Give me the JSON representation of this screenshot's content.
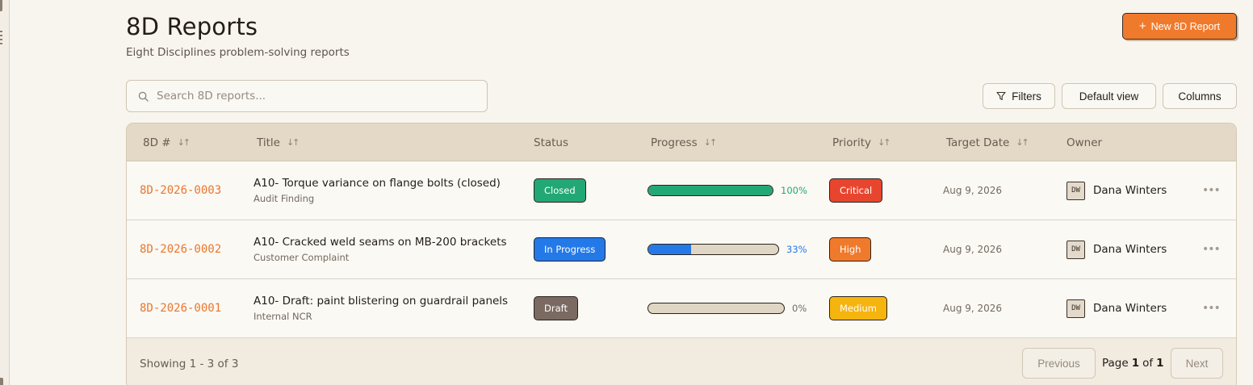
{
  "header": {
    "title": "8D Reports",
    "subtitle": "Eight Disciplines problem-solving reports",
    "new_button": "New 8D Report"
  },
  "toolbar": {
    "search_placeholder": "Search 8D reports...",
    "filters": "Filters",
    "default_view": "Default view",
    "columns": "Columns"
  },
  "table": {
    "columns": [
      "8D #",
      "Title",
      "Status",
      "Progress",
      "Priority",
      "Target Date",
      "Owner"
    ],
    "rows": [
      {
        "id": "8D-2026-0003",
        "title": "A10- Torque variance on flange bolts (closed)",
        "source": "Audit Finding",
        "status": "Closed",
        "progress": 100,
        "progress_label": "100%",
        "priority": "Critical",
        "target_date": "Aug 9, 2026",
        "owner_initials": "DW",
        "owner": "Dana Winters"
      },
      {
        "id": "8D-2026-0002",
        "title": "A10- Cracked weld seams on MB-200 brackets",
        "source": "Customer Complaint",
        "status": "In Progress",
        "progress": 33,
        "progress_label": "33%",
        "priority": "High",
        "target_date": "Aug 9, 2026",
        "owner_initials": "DW",
        "owner": "Dana Winters"
      },
      {
        "id": "8D-2026-0001",
        "title": "A10- Draft: paint blistering on guardrail panels",
        "source": "Internal NCR",
        "status": "Draft",
        "progress": 0,
        "progress_label": "0%",
        "priority": "Medium",
        "target_date": "Aug 9, 2026",
        "owner_initials": "DW",
        "owner": "Dana Winters"
      }
    ]
  },
  "footer": {
    "showing": "Showing 1 - 3 of 3",
    "previous": "Previous",
    "page_prefix": "Page",
    "page_current": "1",
    "page_of": "of",
    "page_total": "1",
    "next": "Next"
  },
  "colors": {
    "accent": "#f07a2c",
    "status_closed": "#22a874",
    "status_in_progress": "#2479e8",
    "status_draft": "#7a6a62",
    "priority_critical": "#e8452f",
    "priority_high": "#f07a2c",
    "priority_medium": "#f6b40e"
  },
  "icons": {
    "search": "search-icon",
    "filter": "filter-icon",
    "plus": "plus-icon",
    "sort": "sort-icon",
    "more": "more-icon"
  }
}
